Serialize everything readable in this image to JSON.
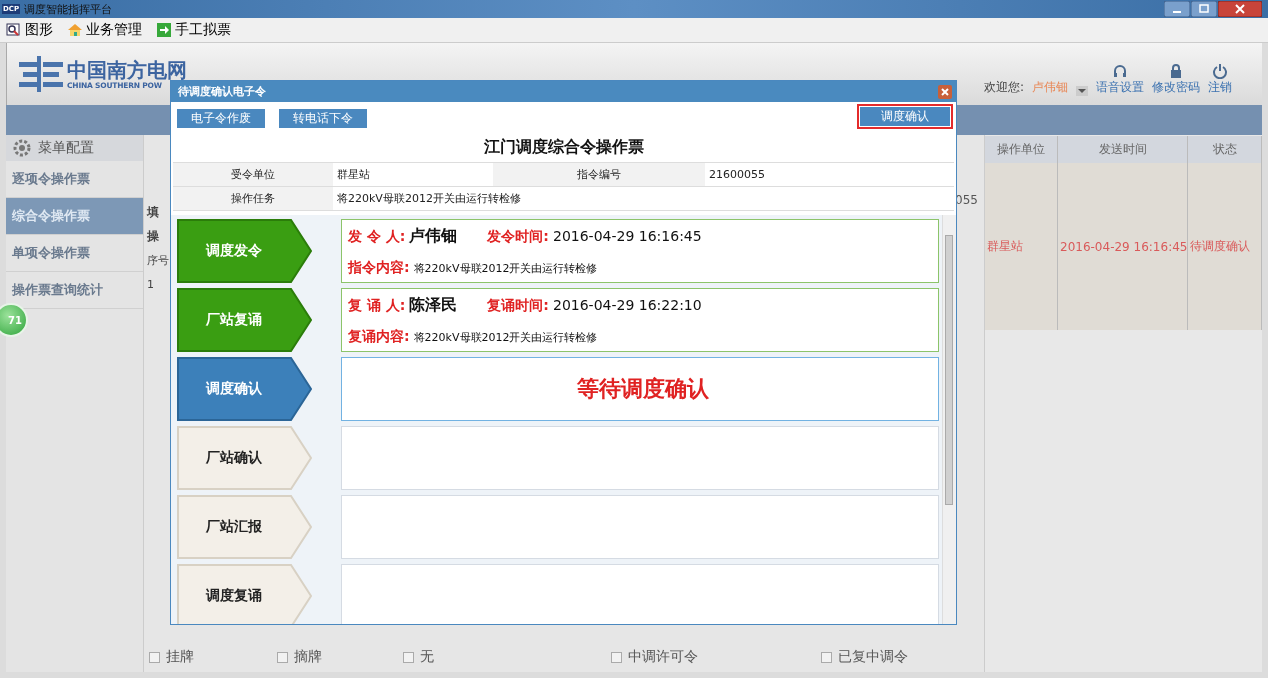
{
  "window": {
    "icon_text": "DCP",
    "title": "调度智能指挥平台"
  },
  "menu": [
    {
      "label": "图形"
    },
    {
      "label": "业务管理"
    },
    {
      "label": "手工拟票"
    }
  ],
  "header": {
    "logo_cn": "中国南方电网",
    "logo_en": "CHINA SOUTHERN POW",
    "welcome": "欢迎您:",
    "user": "卢伟钿",
    "links": [
      "语音设置",
      "修改密码",
      "注销"
    ]
  },
  "sidebar": {
    "title": "菜单配置",
    "items": [
      {
        "label": "逐项令操作票",
        "selected": false
      },
      {
        "label": "综合令操作票",
        "selected": true
      },
      {
        "label": "单项令操作票",
        "selected": false
      },
      {
        "label": "操作票查询统计",
        "selected": false
      }
    ]
  },
  "badge": "71",
  "middle_fragments": [
    "填",
    "操",
    "序号",
    "1"
  ],
  "ticket_no_fragment": "055",
  "right_table": {
    "columns": [
      "操作单位",
      "发送时间",
      "状态"
    ],
    "rows": [
      [
        "群星站",
        "2016-04-29 16:16:45",
        "待调度确认"
      ]
    ]
  },
  "options": [
    {
      "label": "挂牌",
      "checked": false
    },
    {
      "label": "摘牌",
      "checked": false
    },
    {
      "label": "无",
      "checked": false
    },
    {
      "label": "中调许可令",
      "checked": false
    },
    {
      "label": "已复中调令",
      "checked": false
    }
  ],
  "dialog": {
    "title": "待调度确认电子令",
    "left_buttons": [
      "电子令作废",
      "转电话下令"
    ],
    "confirm_button": {
      "label": "调度确认",
      "highlighted": true
    },
    "heading": "江门调度综合令操作票",
    "info": {
      "unit_label": "受令单位",
      "unit": "群星站",
      "no_label": "指令编号",
      "no": "21600055",
      "task_label": "操作任务",
      "task": "将220kV母联2012开关由运行转检修"
    },
    "steps": [
      {
        "label": "调度发令",
        "kind": "done",
        "person_label": "发 令 人:",
        "person": "卢伟钿",
        "time_label": "发令时间:",
        "time": "2016-04-29 16:16:45",
        "content_label": "指令内容:",
        "content": "将220kV母联2012开关由运行转检修"
      },
      {
        "label": "厂站复诵",
        "kind": "done",
        "person_label": "复 诵 人:",
        "person": "陈泽民",
        "time_label": "复诵时间:",
        "time": "2016-04-29 16:22:10",
        "content_label": "复诵内容:",
        "content": "将220kV母联2012开关由运行转检修"
      },
      {
        "label": "调度确认",
        "kind": "active",
        "status": "等待调度确认"
      },
      {
        "label": "厂站确认",
        "kind": "pending"
      },
      {
        "label": "厂站汇报",
        "kind": "pending"
      },
      {
        "label": "调度复诵",
        "kind": "pending"
      }
    ]
  }
}
